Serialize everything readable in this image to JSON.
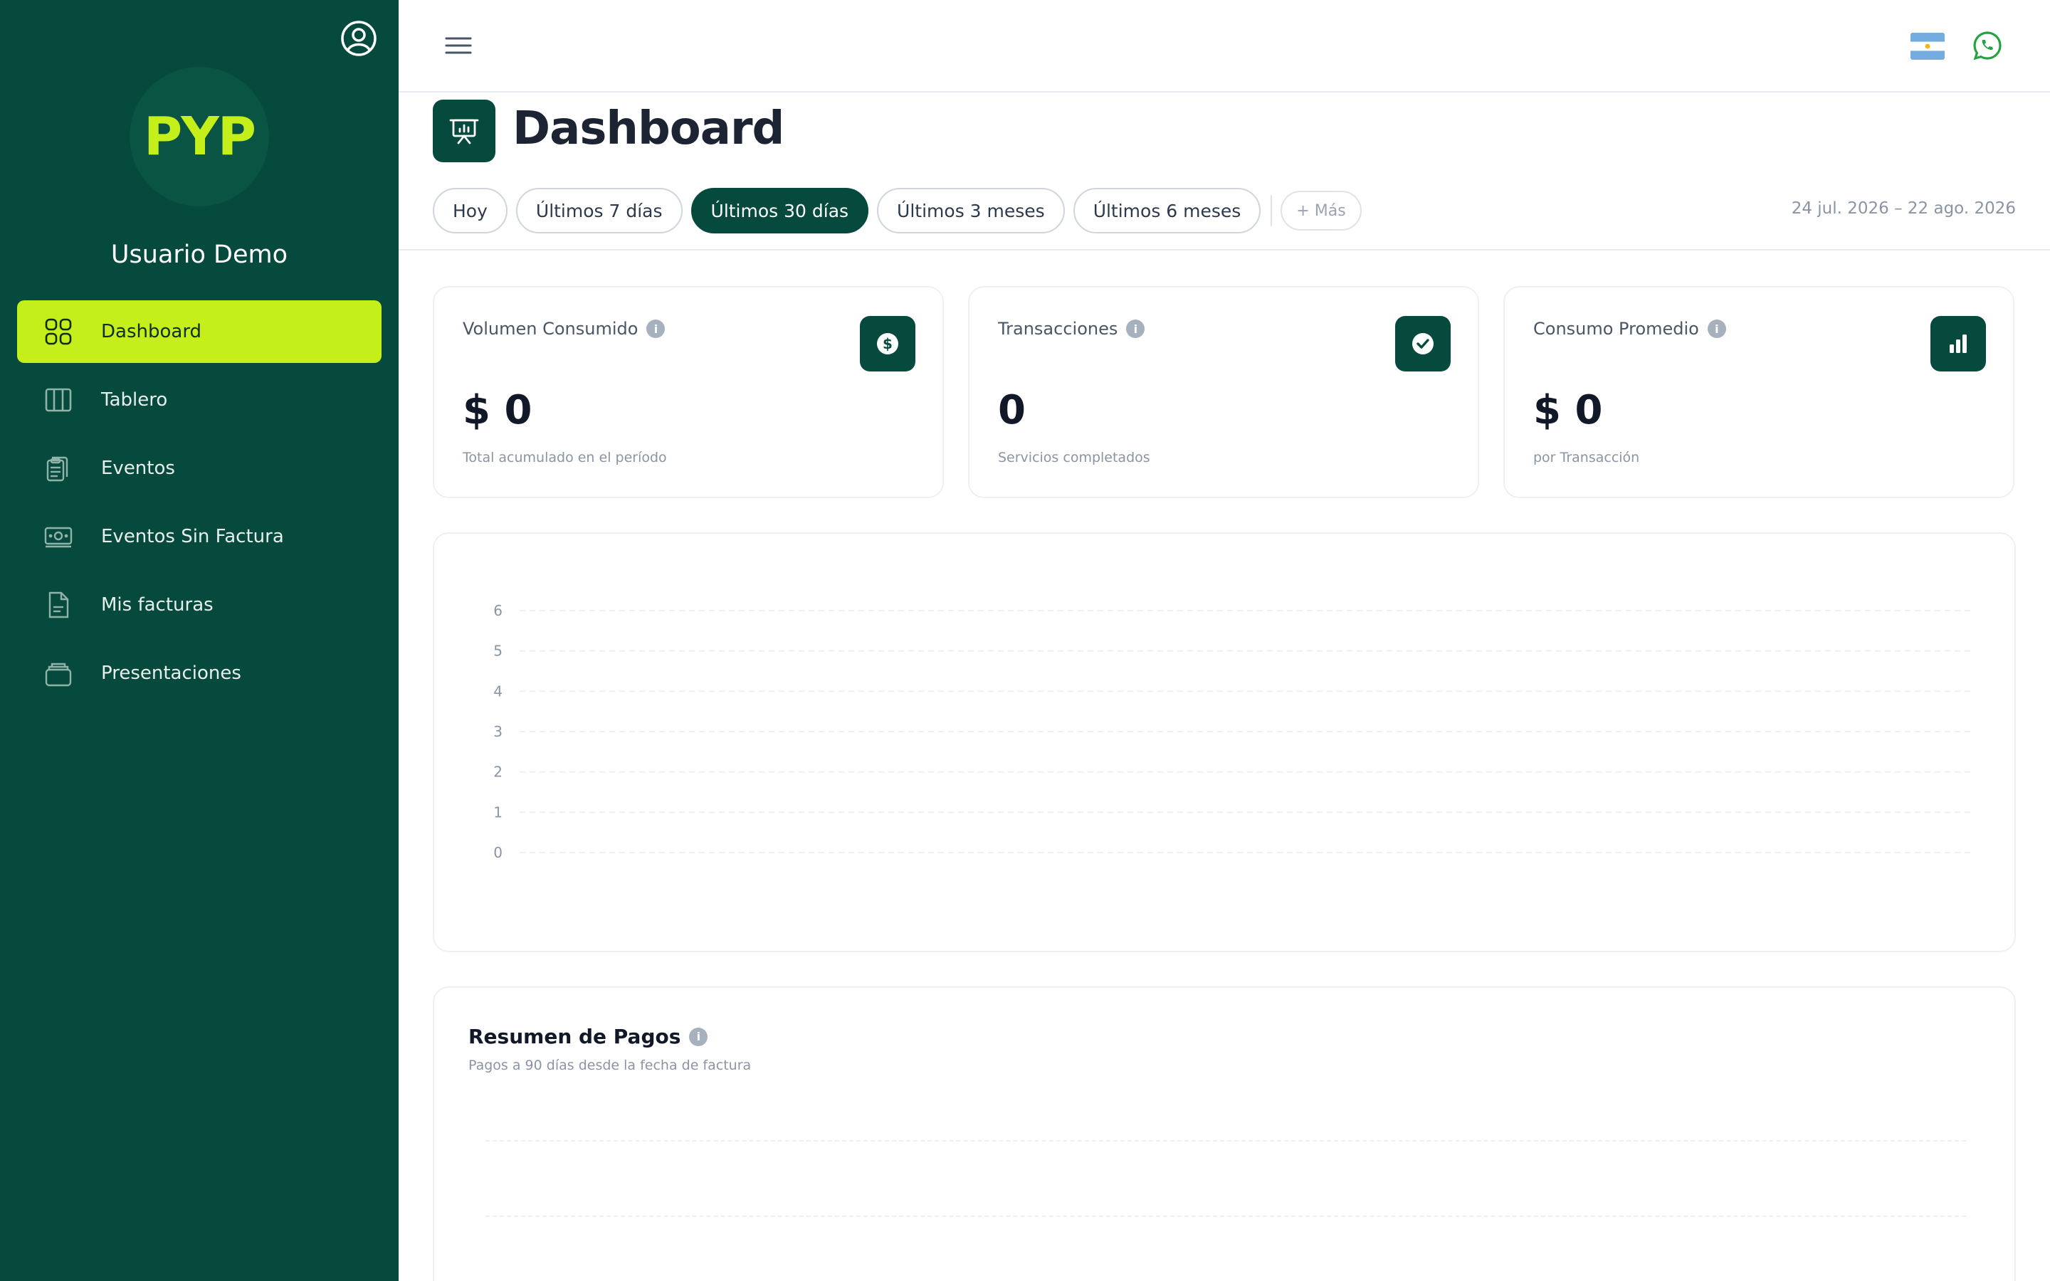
{
  "sidebar": {
    "logo_text": "PYP",
    "user_name": "Usuario Demo",
    "items": [
      {
        "label": "Dashboard",
        "icon": "grid-icon",
        "active": true
      },
      {
        "label": "Tablero",
        "icon": "columns-icon"
      },
      {
        "label": "Eventos",
        "icon": "clipboard-icon"
      },
      {
        "label": "Eventos Sin Factura",
        "icon": "cash-icon"
      },
      {
        "label": "Mis facturas",
        "icon": "document-icon"
      },
      {
        "label": "Presentaciones",
        "icon": "stack-icon"
      }
    ]
  },
  "topbar": {
    "menu_icon": "hamburger-icon",
    "flag_icon": "argentina-flag-icon",
    "chat_icon": "whatsapp-icon"
  },
  "page": {
    "title": "Dashboard",
    "filters": [
      "Hoy",
      "Últimos 7 días",
      "Últimos 30 días",
      "Últimos 3 meses",
      "Últimos 6 meses"
    ],
    "active_filter": "Últimos 30 días",
    "more_label": "+ Más",
    "date_range": "24 jul. 2026 – 22 ago. 2026"
  },
  "cards": [
    {
      "label": "Volumen Consumido",
      "value": "$ 0",
      "sub": "Total acumulado en el período",
      "icon": "dollar-icon"
    },
    {
      "label": "Transacciones",
      "value": "0",
      "sub": "Servicios completados",
      "icon": "check-icon"
    },
    {
      "label": "Consumo Promedio",
      "value": "$ 0",
      "sub": "por Transacción",
      "icon": "bar-chart-icon"
    }
  ],
  "chart_data": {
    "type": "line",
    "y_ticks": [
      "6",
      "5",
      "4",
      "3",
      "2",
      "1",
      "0"
    ],
    "ylim": [
      0,
      6
    ],
    "grid": true
  },
  "payments": {
    "title": "Resumen de Pagos",
    "subtitle": "Pagos a 90 días desde la fecha de factura"
  },
  "colors": {
    "sidebar_bg": "#054a3c",
    "accent": "#c5ef1b",
    "primary": "#054a3c"
  }
}
